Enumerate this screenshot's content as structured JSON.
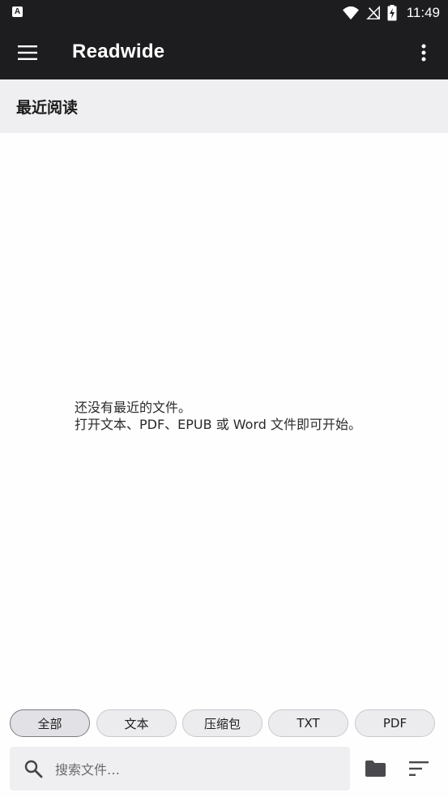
{
  "status_bar": {
    "left_icon": "A",
    "time": "11:49",
    "icons": [
      "wifi-icon",
      "no-signal-icon",
      "battery-charging-icon"
    ]
  },
  "app_bar": {
    "title": "Readwide",
    "menu_icon": "hamburger-menu-icon",
    "overflow_icon": "more-vert-icon"
  },
  "section": {
    "title": "最近阅读"
  },
  "empty_state": {
    "line1": "还没有最近的文件。",
    "line2": "打开文本、PDF、EPUB 或 Word 文件即可开始。"
  },
  "filters": {
    "selected": "全部",
    "chips": [
      {
        "label": "全部"
      },
      {
        "label": "文本"
      },
      {
        "label": "压缩包"
      },
      {
        "label": "TXT"
      },
      {
        "label": "PDF"
      }
    ]
  },
  "search": {
    "placeholder": "搜索文件…",
    "value": ""
  },
  "bottom_actions": {
    "folder_icon": "folder-icon",
    "sort_icon": "sort-icon"
  },
  "colors": {
    "bar_bg": "#1d1d20",
    "section_bg": "#efeff1",
    "chip_bg": "#ececef"
  }
}
